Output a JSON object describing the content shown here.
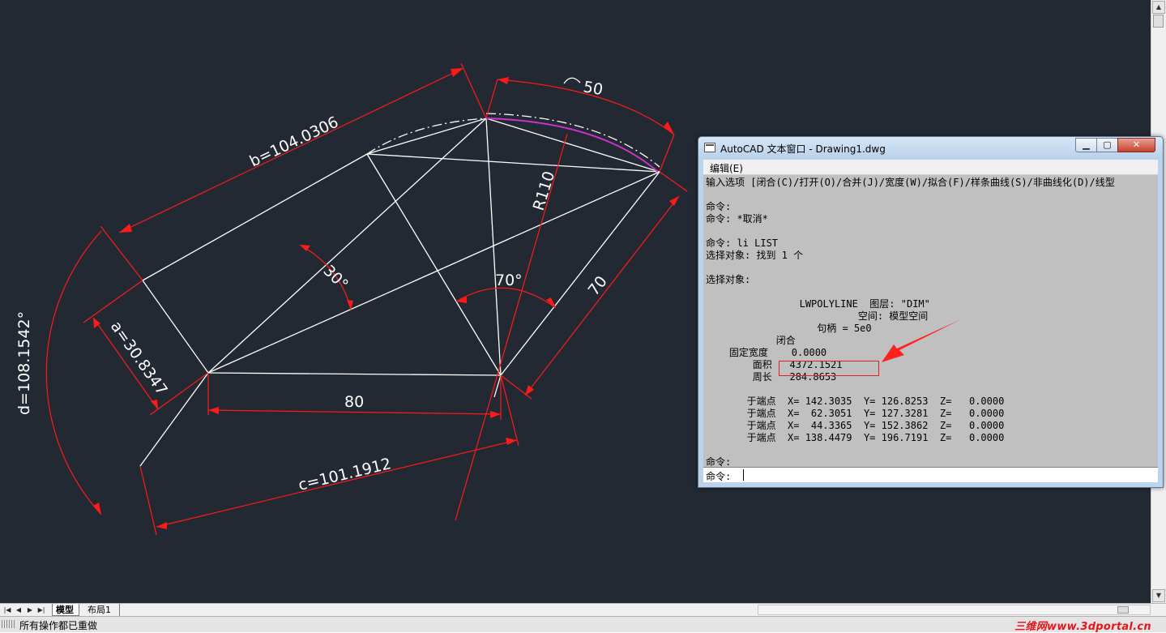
{
  "drawing": {
    "dim_b": "b=104.0306",
    "dim_arc": "50",
    "dim_r": "R110",
    "dim_30": "30°",
    "dim_70_angle": "70°",
    "dim_70": "70",
    "dim_a": "a=30.8347",
    "dim_d": "d=108.1542°",
    "dim_80": "80",
    "dim_c": "c=101.1912"
  },
  "tabs": {
    "model": "模型",
    "layout1": "布局1"
  },
  "status": {
    "text": "所有操作都已重做",
    "watermark": "三维网www.3dportal.cn"
  },
  "text_window": {
    "title": "AutoCAD 文本窗口 - Drawing1.dwg",
    "menu_edit": "编辑(E)",
    "lines": [
      "输入选项 [闭合(C)/打开(O)/合并(J)/宽度(W)/拟合(F)/样条曲线(S)/非曲线化(D)/线型",
      "",
      "命令:",
      "命令: *取消*",
      "",
      "命令: li LIST",
      "选择对象: 找到 1 个",
      "",
      "选择对象:",
      "",
      "                LWPOLYLINE  图层: \"DIM\"",
      "                          空间: 模型空间",
      "                   句柄 = 5e0",
      "            闭合",
      "    固定宽度    0.0000",
      "        面积   4372.1521",
      "        周长   284.8653",
      "",
      "       于端点  X= 142.3035  Y= 126.8253  Z=   0.0000",
      "       于端点  X=  62.3051  Y= 127.3281  Z=   0.0000",
      "       于端点  X=  44.3365  Y= 152.3862  Z=   0.0000",
      "       于端点  X= 138.4479  Y= 196.7191  Z=   0.0000",
      "",
      "命令:"
    ],
    "input_label": "命令:"
  },
  "colors": {
    "canvas": "#232933",
    "geometry": "#ffffff",
    "dimension": "#ff1a1a",
    "arc_highlight": "#cc33cc"
  }
}
